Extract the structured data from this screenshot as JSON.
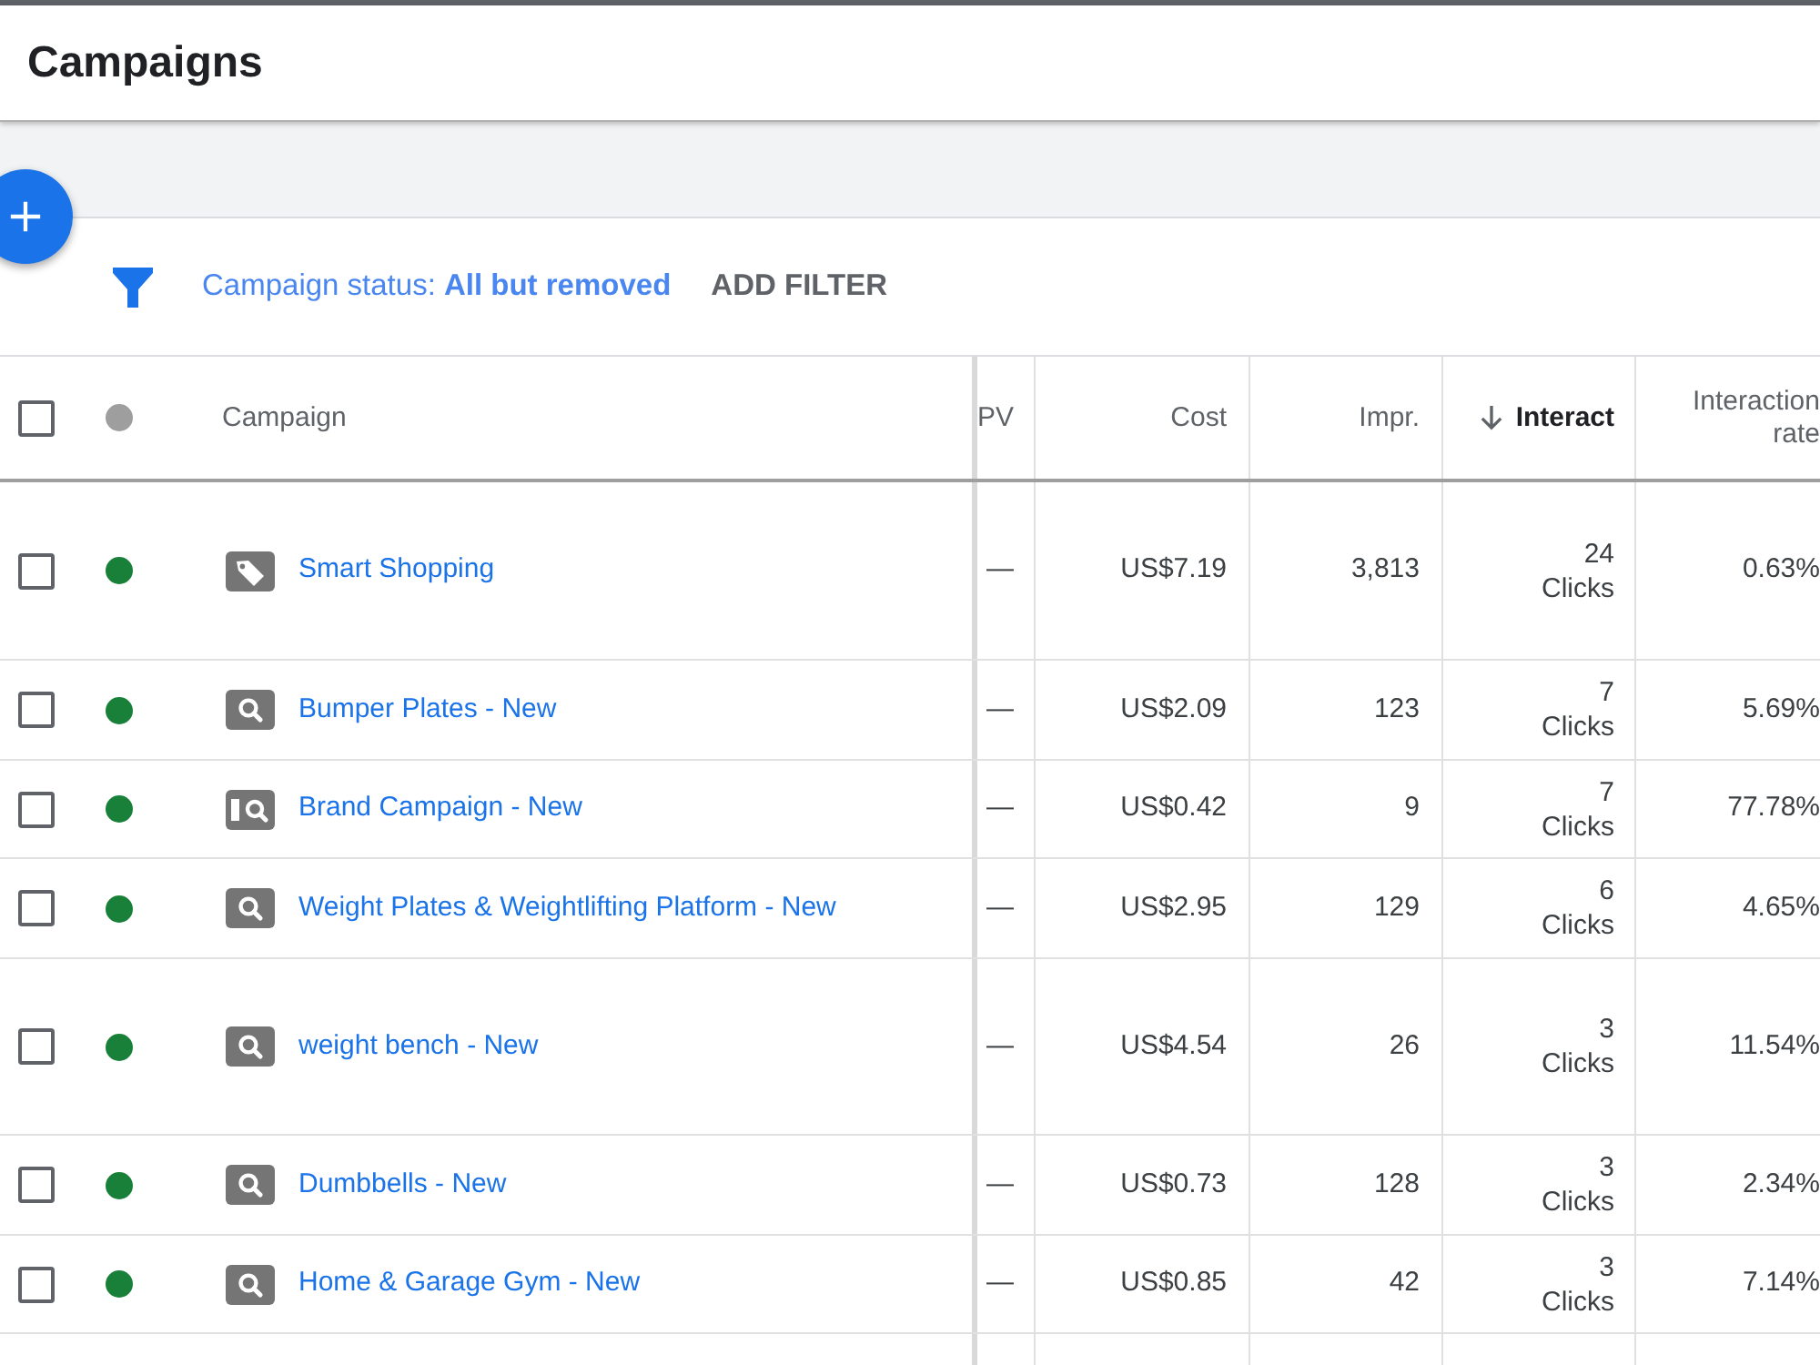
{
  "header": {
    "title": "Campaigns"
  },
  "filter_bar": {
    "status_filter": "Campaign status: **All but removed**",
    "add_filter": "ADD FILTER"
  },
  "table": {
    "select_all": {
      "checked": false
    },
    "columns": [
      {
        "label": "Campaign",
        "sorted": false
      },
      {
        "label": "PV",
        "sorted": false
      },
      {
        "label": "Cost",
        "sorted": false
      },
      {
        "label": "Impr.",
        "sorted": false
      },
      {
        "label": "Interact",
        "sorted": true
      },
      {
        "label": "Interaction rate",
        "sorted": false
      }
    ],
    "rows": [
      {
        "checked": false,
        "color": "#188038",
        "kind": "shopping",
        "name": "Smart Shopping",
        "cpv": "—",
        "cost": "US$7.19",
        "impressions": "3,813",
        "interactions": "24",
        "interaction_unit": "Clicks",
        "interaction_rate": "0.63%"
      },
      {
        "checked": false,
        "color": "#188038",
        "kind": "search",
        "name": "Bumper Plates - New",
        "cpv": "—",
        "cost": "US$2.09",
        "impressions": "123",
        "interactions": "7",
        "interaction_unit": "Clicks",
        "interaction_rate": "5.69%"
      },
      {
        "checked": false,
        "color": "#188038",
        "kind": "brand",
        "name": "Brand Campaign - New",
        "cpv": "—",
        "cost": "US$0.42",
        "impressions": "9",
        "interactions": "7",
        "interaction_unit": "Clicks",
        "interaction_rate": "77.78%"
      },
      {
        "checked": false,
        "color": "#188038",
        "kind": "search",
        "name": "Weight Plates & Weightlifting Platform - New",
        "cpv": "—",
        "cost": "US$2.95",
        "impressions": "129",
        "interactions": "6",
        "interaction_unit": "Clicks",
        "interaction_rate": "4.65%"
      },
      {
        "checked": false,
        "color": "#188038",
        "kind": "search",
        "name": "weight bench - New",
        "cpv": "—",
        "cost": "US$4.54",
        "impressions": "26",
        "interactions": "3",
        "interaction_unit": "Clicks",
        "interaction_rate": "11.54%"
      },
      {
        "checked": false,
        "color": "#188038",
        "kind": "search",
        "name": "Dumbbells - New",
        "cpv": "—",
        "cost": "US$0.73",
        "impressions": "128",
        "interactions": "3",
        "interaction_unit": "Clicks",
        "interaction_rate": "2.34%"
      },
      {
        "checked": false,
        "color": "#188038",
        "kind": "search",
        "name": "Home & Garage Gym - New",
        "cpv": "—",
        "cost": "US$0.85",
        "impressions": "42",
        "interactions": "3",
        "interaction_unit": "Clicks",
        "interaction_rate": "7.14%"
      }
    ]
  }
}
